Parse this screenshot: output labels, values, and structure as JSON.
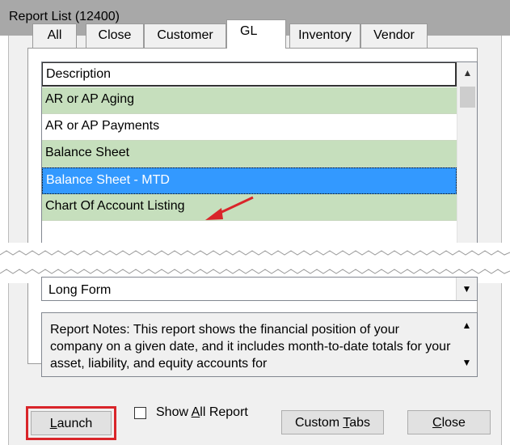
{
  "window": {
    "title": "Report List (12400)"
  },
  "tabs": [
    {
      "label": "All"
    },
    {
      "label": "Close"
    },
    {
      "label": "Customer"
    },
    {
      "label": "GL",
      "active": true
    },
    {
      "label": "Inventory"
    },
    {
      "label": "Vendor"
    }
  ],
  "report_list": {
    "header": "Description",
    "rows": [
      {
        "label": "AR or AP Aging",
        "style": "green"
      },
      {
        "label": "AR or AP Payments",
        "style": "white"
      },
      {
        "label": "Balance Sheet",
        "style": "green"
      },
      {
        "label": "Balance Sheet - MTD",
        "style": "selected"
      },
      {
        "label": "Chart Of Account Listing",
        "style": "green"
      }
    ]
  },
  "format_select": {
    "value": "Long Form"
  },
  "report_notes": {
    "text": "Report Notes:  This report shows the financial position of your company on a given date, and it includes month-to-date totals for your asset, liability, and equity accounts for"
  },
  "buttons": {
    "launch": {
      "underlined": "L",
      "rest": "aunch"
    },
    "custom_tabs": {
      "before": "Custom ",
      "underlined": "T",
      "rest": "abs"
    },
    "close": {
      "underlined": "C",
      "rest": "lose"
    }
  },
  "show_all": {
    "before": "Show ",
    "underlined": "A",
    "rest": "ll Report",
    "checked": false
  },
  "colors": {
    "row_green": "#c6dfbd",
    "selection": "#3399ff",
    "highlight_outline": "#d9252a",
    "arrow": "#d9252a"
  },
  "icons": {
    "scroll_up": "▲-caret",
    "scroll_down": "▼-caret",
    "dropdown": "chevron-down"
  }
}
